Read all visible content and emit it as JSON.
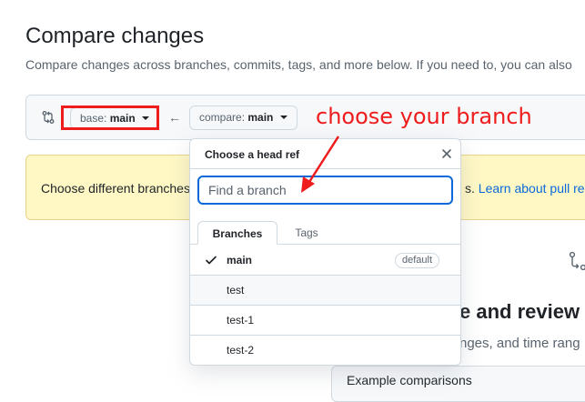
{
  "page": {
    "title": "Compare changes",
    "subtitle": "Compare changes across branches, commits, tags, and more below. If you need to, you can also"
  },
  "range": {
    "compare_icon": "git-compare-icon",
    "base_label": "base:",
    "base_value": "main",
    "arrow": "←",
    "compare_label": "compare:",
    "compare_value": "main"
  },
  "annotation": {
    "text": "choose your branch",
    "color": "#ee1c1c"
  },
  "flash": {
    "text": "Choose different branches",
    "tail_text": "s.",
    "link": "Learn about pull re"
  },
  "background": {
    "heading": "e and review",
    "text": "nges, and time rang",
    "box_label": "Example comparisons"
  },
  "popover": {
    "title": "Choose a head ref",
    "close_icon": "x-icon",
    "search_placeholder": "Find a branch",
    "tabs": [
      "Branches",
      "Tags"
    ],
    "branches": [
      {
        "name": "main",
        "badge": "default",
        "selected": true
      },
      {
        "name": "test",
        "badge": "",
        "selected": false
      },
      {
        "name": "test-1",
        "badge": "",
        "selected": false
      },
      {
        "name": "test-2",
        "badge": "",
        "selected": false
      }
    ]
  },
  "colors": {
    "accent": "#0969da",
    "flash_bg": "#fff8c5",
    "annotation": "#ee1c1c"
  }
}
